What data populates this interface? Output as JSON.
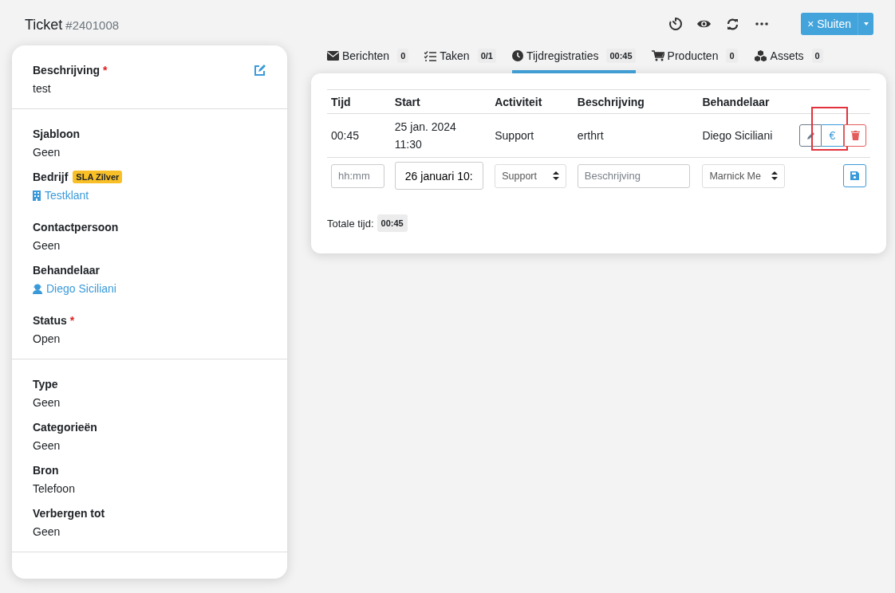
{
  "header": {
    "title": "Ticket",
    "number": "#2401008",
    "tools": [
      {
        "kind": "timer"
      },
      {
        "kind": "eye"
      },
      {
        "kind": "refresh"
      },
      {
        "kind": "more"
      }
    ],
    "close_button": {
      "icon": "×",
      "label": "Sluiten"
    }
  },
  "sidebar": {
    "sections": [
      {
        "fields": [
          {
            "kind": "text",
            "label": "Beschrijving",
            "marker": "*",
            "value": "test",
            "editable": true
          }
        ]
      },
      {
        "fields": [
          {
            "kind": "text",
            "label": "Sjabloon",
            "value": "Geen"
          },
          {
            "kind": "company",
            "label": "Bedrijf",
            "badge": "SLA Zilver",
            "value": "Testklant"
          },
          {
            "kind": "text",
            "label": "Contactpersoon",
            "value": "Geen"
          },
          {
            "kind": "user",
            "label": "Behandelaar",
            "value": "Diego Siciliani"
          },
          {
            "kind": "text",
            "label": "Status",
            "marker": "*",
            "value": "Open"
          }
        ]
      },
      {
        "fields": [
          {
            "kind": "text",
            "label": "Type",
            "value": "Geen"
          },
          {
            "kind": "text",
            "label": "Categorieën",
            "value": "Geen"
          },
          {
            "kind": "text",
            "label": "Bron",
            "value": "Telefoon"
          },
          {
            "kind": "text",
            "label": "Verbergen tot",
            "value": "Geen"
          }
        ]
      }
    ]
  },
  "tabs": [
    {
      "label": "Berichten",
      "count": "0",
      "selected": false
    },
    {
      "label": "Taken",
      "count": "0/1",
      "selected": false
    },
    {
      "label": "Tijdregistraties",
      "count": "00:45",
      "selected": true
    },
    {
      "label": "Producten",
      "count": "0",
      "selected": false
    },
    {
      "label": "Assets",
      "count": "0",
      "selected": false
    }
  ],
  "table": {
    "columns": [
      "Tijd",
      "Start",
      "Activiteit",
      "Beschrijving",
      "Behandelaar"
    ],
    "rows": [
      {
        "cells": [
          "00:45",
          "25 jan. 2024\n11:30",
          "Support",
          "erthrt",
          "Diego Siciliani"
        ],
        "actions": [
          {
            "kind": "edit",
            "highlighted": false
          },
          {
            "kind": "price",
            "label": "€",
            "highlighted": true
          },
          {
            "kind": "delete",
            "highlighted": false
          }
        ]
      }
    ],
    "new_entry": [
      {
        "kind": "input",
        "placeholder": "hh:mm"
      },
      {
        "kind": "input",
        "value": "26 januari 10:"
      },
      {
        "kind": "select",
        "value": "Support"
      },
      {
        "kind": "input",
        "placeholder": "Beschrijving"
      },
      {
        "kind": "select",
        "value": "Marnick Me"
      },
      {
        "kind": "save"
      }
    ],
    "total_label": "Totale tijd:",
    "total_value": "00:45"
  }
}
